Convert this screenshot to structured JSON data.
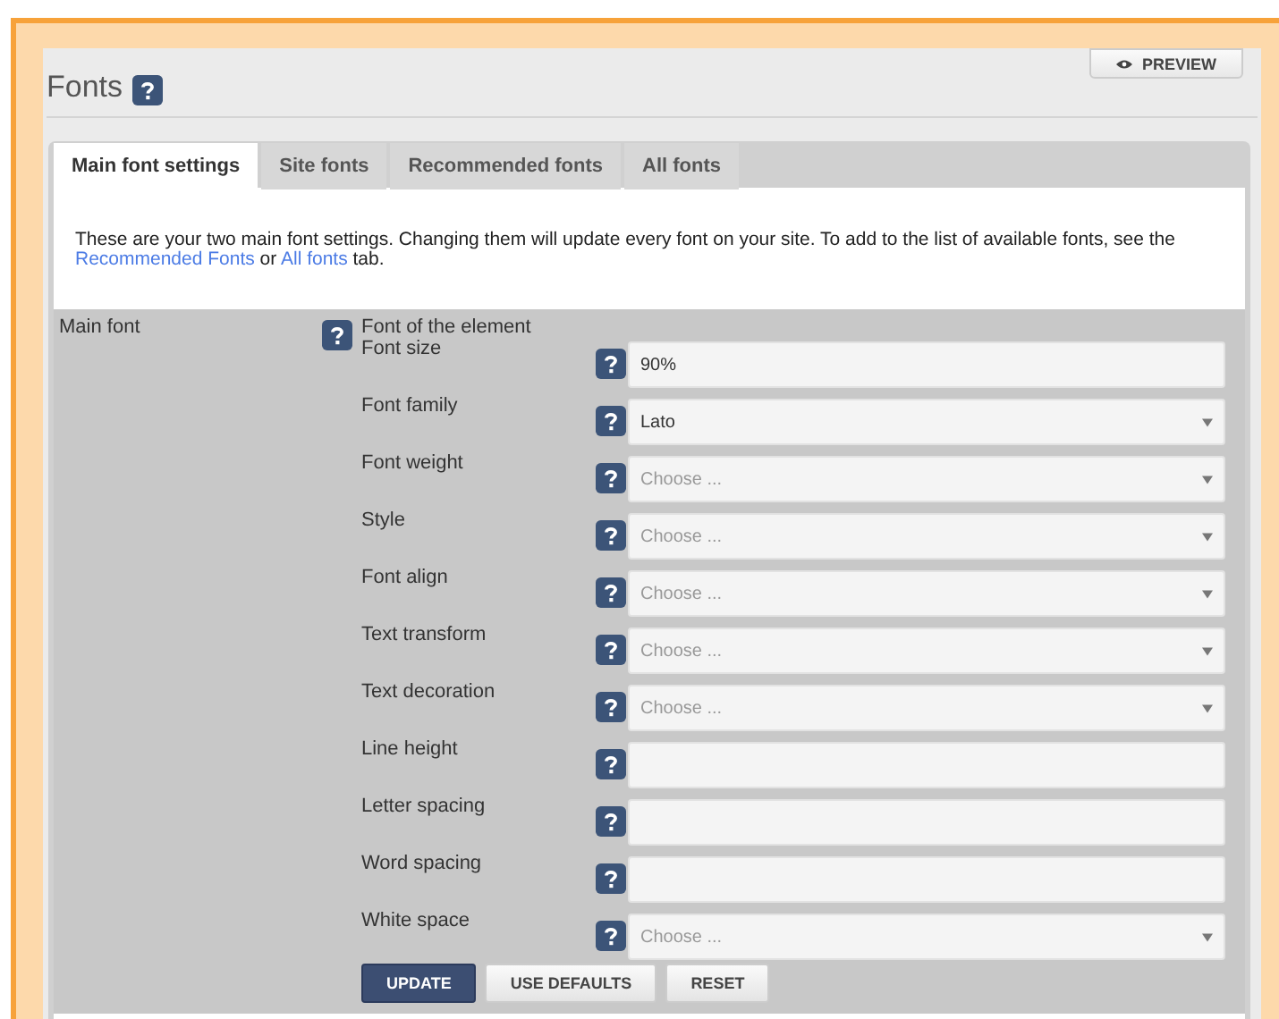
{
  "page": {
    "title": "Fonts"
  },
  "preview_button": "PREVIEW",
  "tabs": [
    {
      "label": "Main font settings",
      "selected": true
    },
    {
      "label": "Site fonts",
      "selected": false
    },
    {
      "label": "Recommended fonts",
      "selected": false
    },
    {
      "label": "All fonts",
      "selected": false
    }
  ],
  "intro": {
    "text": "These are your two main font settings. Changing them will update every font on your site. To add to the list of available fonts, see the",
    "link_1": "Recommended Fonts",
    "middle": "or",
    "link_2": "All fonts",
    "end": "tab."
  },
  "section": {
    "label": "Main font",
    "heading": "Font of the element"
  },
  "fields": [
    {
      "label": "Font size",
      "kind": "text",
      "value": "90%"
    },
    {
      "label": "Font family",
      "kind": "select",
      "value": "Lato"
    },
    {
      "label": "Font weight",
      "kind": "select",
      "placeholder": "Choose ..."
    },
    {
      "label": "Style",
      "kind": "select",
      "placeholder": "Choose ..."
    },
    {
      "label": "Font align",
      "kind": "select",
      "placeholder": "Choose ..."
    },
    {
      "label": "Text transform",
      "kind": "select",
      "placeholder": "Choose ..."
    },
    {
      "label": "Text decoration",
      "kind": "select",
      "placeholder": "Choose ..."
    },
    {
      "label": "Line height",
      "kind": "text"
    },
    {
      "label": "Letter spacing",
      "kind": "text"
    },
    {
      "label": "Word spacing",
      "kind": "text"
    },
    {
      "label": "White space",
      "kind": "select",
      "placeholder": "Choose ..."
    }
  ],
  "buttons": [
    {
      "label": "UPDATE",
      "kind": "primary"
    },
    {
      "label": "USE DEFAULTS",
      "kind": "secondary"
    },
    {
      "label": "RESET",
      "kind": "secondary"
    }
  ]
}
